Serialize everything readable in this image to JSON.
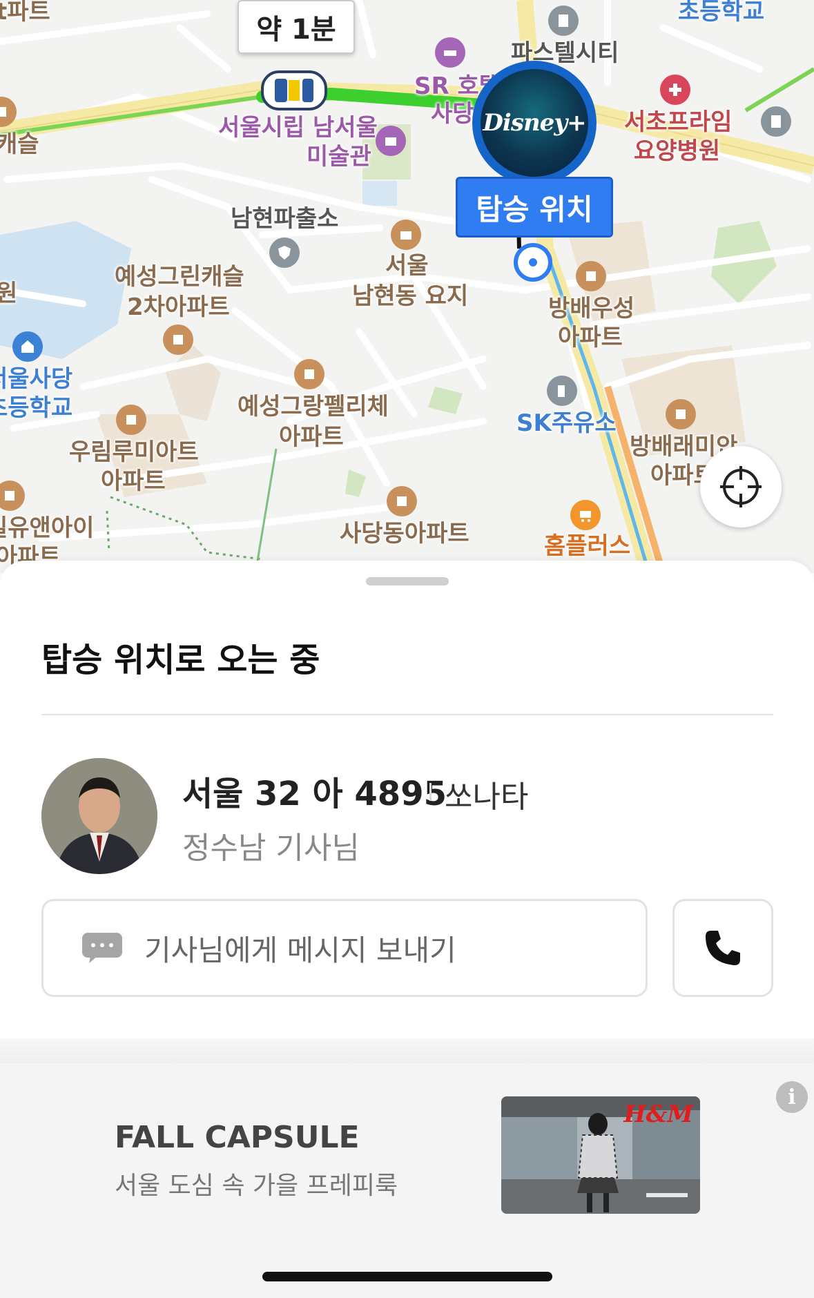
{
  "map": {
    "eta": "약 1분",
    "pickup_label": "탑승 위치",
    "sponsor_badge_text": "Disney+",
    "labels": {
      "apt_top_left": "t파트",
      "caesle_left": "캐슬",
      "won_left": "원",
      "sr_hotel": "SR 호텔",
      "sadang_partial": "사당",
      "paste_city": "파스텔시티",
      "elementary_top": "초등학교",
      "seocho_prime": "서초프라임",
      "nursing_hospital": "요양병원",
      "museum_line1": "서울시립 남서울",
      "museum_line2": "미술관",
      "namhyeon_police": "남현파출소",
      "yesung_green_1": "예성그린캐슬",
      "yesung_green_2": "2차아파트",
      "seoul_yoji_1": "서울",
      "seoul_yoji_2": "남현동 요지",
      "bangbae_woosung_1": "방배우성",
      "bangbae_woosung_2": "아파트",
      "seoul_sadang_1": "서울사당",
      "seoul_sadang_2": "초등학교",
      "yesung_grand_1": "예성그랑펠리체",
      "yesung_grand_2": "아파트",
      "sk_station": "SK주유소",
      "woorim_1": "우림루미아트",
      "woorim_2": "아파트",
      "bangbae_raemian_1": "방배래미안",
      "bangbae_raemian_2": "아파트",
      "iyou_1": "일유앤아이",
      "iyou_2": "아파트",
      "sadang_apt": "사당동아파트",
      "homeplus": "홈플러스"
    }
  },
  "sheet": {
    "title": "탑승 위치로 오는 중",
    "plate": "서울 32 아 4895",
    "car_model": "쏘나타",
    "driver_name": "정수남 기사님",
    "message_placeholder": "기사님에게 메시지 보내기"
  },
  "ad": {
    "title": "FALL CAPSULE",
    "subtitle": "서울 도심 속 가을 프레피룩",
    "brand": "H&M",
    "info_icon": "i"
  },
  "colors": {
    "accent_blue": "#2f7df0",
    "route_green": "#3ccf2e",
    "map_bg": "#f3f3f1"
  }
}
